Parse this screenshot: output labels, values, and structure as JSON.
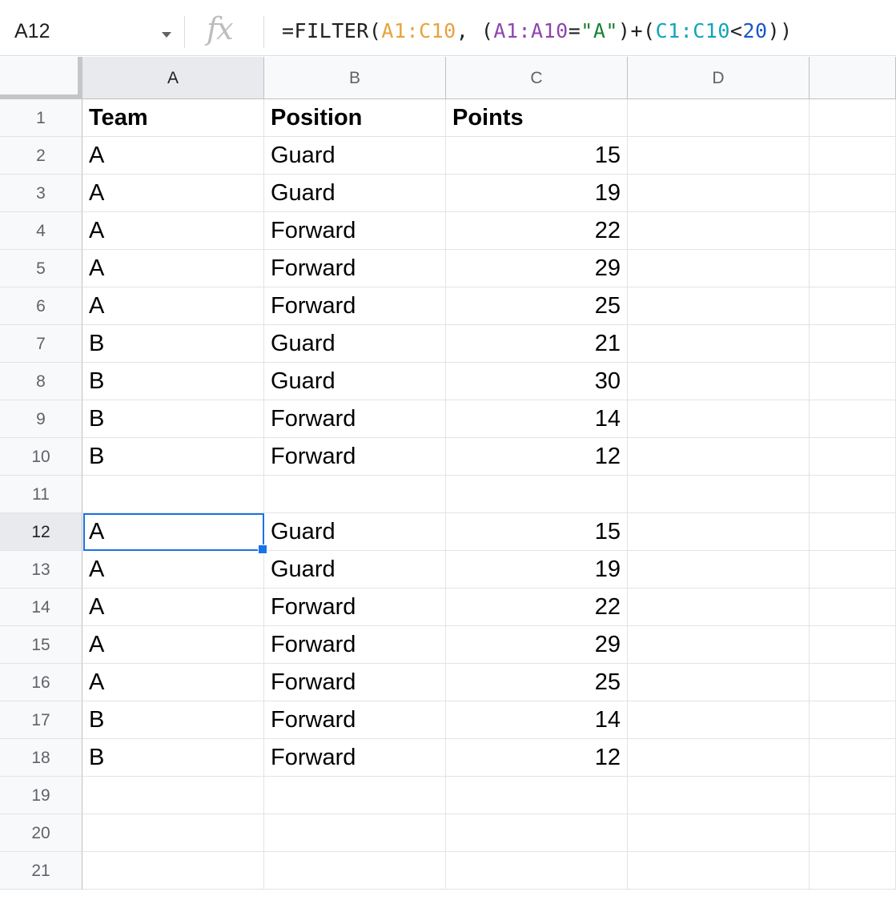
{
  "formula_bar": {
    "name_box": "A12",
    "fx_label": "fx",
    "formula_tokens": [
      {
        "text": "=FILTER(",
        "color": "plain"
      },
      {
        "text": "A1:C10",
        "color": "orange"
      },
      {
        "text": ", (",
        "color": "plain"
      },
      {
        "text": "A1:A10",
        "color": "purple"
      },
      {
        "text": "=",
        "color": "plain"
      },
      {
        "text": "\"A\"",
        "color": "string"
      },
      {
        "text": ")+(",
        "color": "plain"
      },
      {
        "text": "C1:C10",
        "color": "teal"
      },
      {
        "text": "<",
        "color": "plain"
      },
      {
        "text": "20",
        "color": "num"
      },
      {
        "text": "))",
        "color": "plain"
      }
    ]
  },
  "columns": [
    "A",
    "B",
    "C",
    "D"
  ],
  "active_column": "A",
  "active_row": 12,
  "rows": [
    {
      "num": "1",
      "cells": [
        "Team",
        "Position",
        "Points"
      ],
      "header": true
    },
    {
      "num": "2",
      "cells": [
        "A",
        "Guard",
        "15"
      ]
    },
    {
      "num": "3",
      "cells": [
        "A",
        "Guard",
        "19"
      ]
    },
    {
      "num": "4",
      "cells": [
        "A",
        "Forward",
        "22"
      ]
    },
    {
      "num": "5",
      "cells": [
        "A",
        "Forward",
        "29"
      ]
    },
    {
      "num": "6",
      "cells": [
        "A",
        "Forward",
        "25"
      ]
    },
    {
      "num": "7",
      "cells": [
        "B",
        "Guard",
        "21"
      ]
    },
    {
      "num": "8",
      "cells": [
        "B",
        "Guard",
        "30"
      ]
    },
    {
      "num": "9",
      "cells": [
        "B",
        "Forward",
        "14"
      ]
    },
    {
      "num": "10",
      "cells": [
        "B",
        "Forward",
        "12"
      ]
    },
    {
      "num": "11",
      "cells": [
        "",
        "",
        ""
      ]
    },
    {
      "num": "12",
      "cells": [
        "A",
        "Guard",
        "15"
      ]
    },
    {
      "num": "13",
      "cells": [
        "A",
        "Guard",
        "19"
      ]
    },
    {
      "num": "14",
      "cells": [
        "A",
        "Forward",
        "22"
      ]
    },
    {
      "num": "15",
      "cells": [
        "A",
        "Forward",
        "29"
      ]
    },
    {
      "num": "16",
      "cells": [
        "A",
        "Forward",
        "25"
      ]
    },
    {
      "num": "17",
      "cells": [
        "B",
        "Forward",
        "14"
      ]
    },
    {
      "num": "18",
      "cells": [
        "B",
        "Forward",
        "12"
      ]
    },
    {
      "num": "19",
      "cells": [
        "",
        "",
        ""
      ]
    },
    {
      "num": "20",
      "cells": [
        "",
        "",
        ""
      ]
    },
    {
      "num": "21",
      "cells": [
        "",
        "",
        ""
      ]
    }
  ],
  "colors": {
    "plain": "#202124",
    "orange": "#e8a23c",
    "purple": "#8e44ad",
    "string": "#188038",
    "teal": "#12a4b8",
    "num": "#1a56c4",
    "selection": "#1a73e8"
  }
}
